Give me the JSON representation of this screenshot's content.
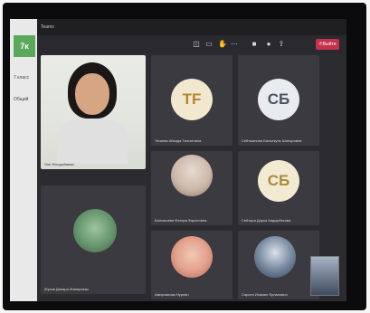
{
  "window": {
    "title": "Teams"
  },
  "sidebar": {
    "team_tile": "7к",
    "class_label": "7 класс",
    "section_label": "Общий"
  },
  "toolbar": {
    "icons": [
      "participants-icon",
      "chat-icon",
      "raise-hand-icon",
      "more-icon",
      "camera-icon",
      "mic-icon",
      "share-icon"
    ],
    "leave_label": "Выйти"
  },
  "participants": [
    {
      "id": "teacher",
      "type": "video",
      "name": "Нэл Жолдыбаева"
    },
    {
      "id": "p1",
      "type": "initials",
      "initials": "TF",
      "name": "Тагаева Айзада Талгатовна"
    },
    {
      "id": "p2",
      "type": "initials",
      "initials": "СБ",
      "name": "Сейтжанова Бахыткуль Шатыровна"
    },
    {
      "id": "p3",
      "type": "photo",
      "name": "Балхашева Фатира Фаритовна"
    },
    {
      "id": "p4",
      "type": "initials",
      "initials": "СБ",
      "name": "Сейтара Дарья Кадырбекова"
    },
    {
      "id": "p5",
      "type": "photo",
      "name": "Жуков Дилара Жанаргазы"
    },
    {
      "id": "p6",
      "type": "photo",
      "name": "Амирханова Нурлан"
    },
    {
      "id": "p7",
      "type": "photo",
      "name": "Сарсен Исмаил Ерланович"
    }
  ]
}
